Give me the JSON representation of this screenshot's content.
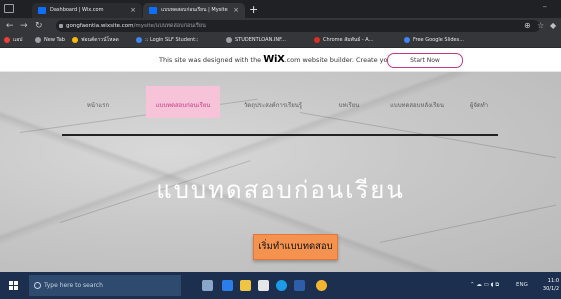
{
  "browser": {
    "tabs": [
      {
        "title": "Dashboard | Wix.com",
        "favicon_color": "#0c6efc"
      },
      {
        "title": "แบบทดสอบก่อนเรียน | Mysite",
        "favicon_color": "#0c6efc"
      }
    ],
    "new_tab_icon": "+",
    "minimize_icon": "–",
    "url_host": "gongfaentia.wixsite.com",
    "url_path": "/mysite/แบบทดสอบก่อนเรียน",
    "bookmarks": [
      {
        "label": "แอป",
        "color": "#ea4335"
      },
      {
        "label": "New Tab",
        "color": "#9aa0a6"
      },
      {
        "label": "ฟอนต์ดาวน์โหลด",
        "color": "#fbbc04"
      },
      {
        "label": ":: Login SLF Student::",
        "color": "#4285f4"
      },
      {
        "label": "STUDENTLOAN.INF...",
        "color": "#9aa0a6"
      },
      {
        "label": "Chrome สัมพันธ์ - A...",
        "color": "#d93025"
      },
      {
        "label": "Free Google Slides...",
        "color": "#4285f4"
      }
    ]
  },
  "wix_banner": {
    "text_before": "This site was designed with the ",
    "brand": "WiX",
    "text_after": ".com website builder. Create your website today.",
    "start_now": "Start Now"
  },
  "site_nav": [
    {
      "label": "หน้าแรก",
      "active": false
    },
    {
      "label": "แบบทดสอบก่อนเรียน",
      "active": true
    },
    {
      "label": "วัตถุประสงค์การเรียนรู้",
      "active": false
    },
    {
      "label": "บทเรียน",
      "active": false
    },
    {
      "label": "แบบทดสอบหลังเรียน",
      "active": false
    },
    {
      "label": "ผู้จัดทำ",
      "active": false
    }
  ],
  "hero": {
    "title": "แบบทดสอบก่อนเรียน",
    "cta_label": "เริ่มทำแบบทดสอบ"
  },
  "taskbar": {
    "search_placeholder": "Type here to search",
    "tray_text": "ENG",
    "time": "11:0",
    "date": "30/1/2"
  },
  "colors": {
    "accent_pink": "#c23c86",
    "active_tab_bg": "#f6c3d9",
    "cta_orange": "#f4934f",
    "taskbar": "#1c2f4e"
  }
}
